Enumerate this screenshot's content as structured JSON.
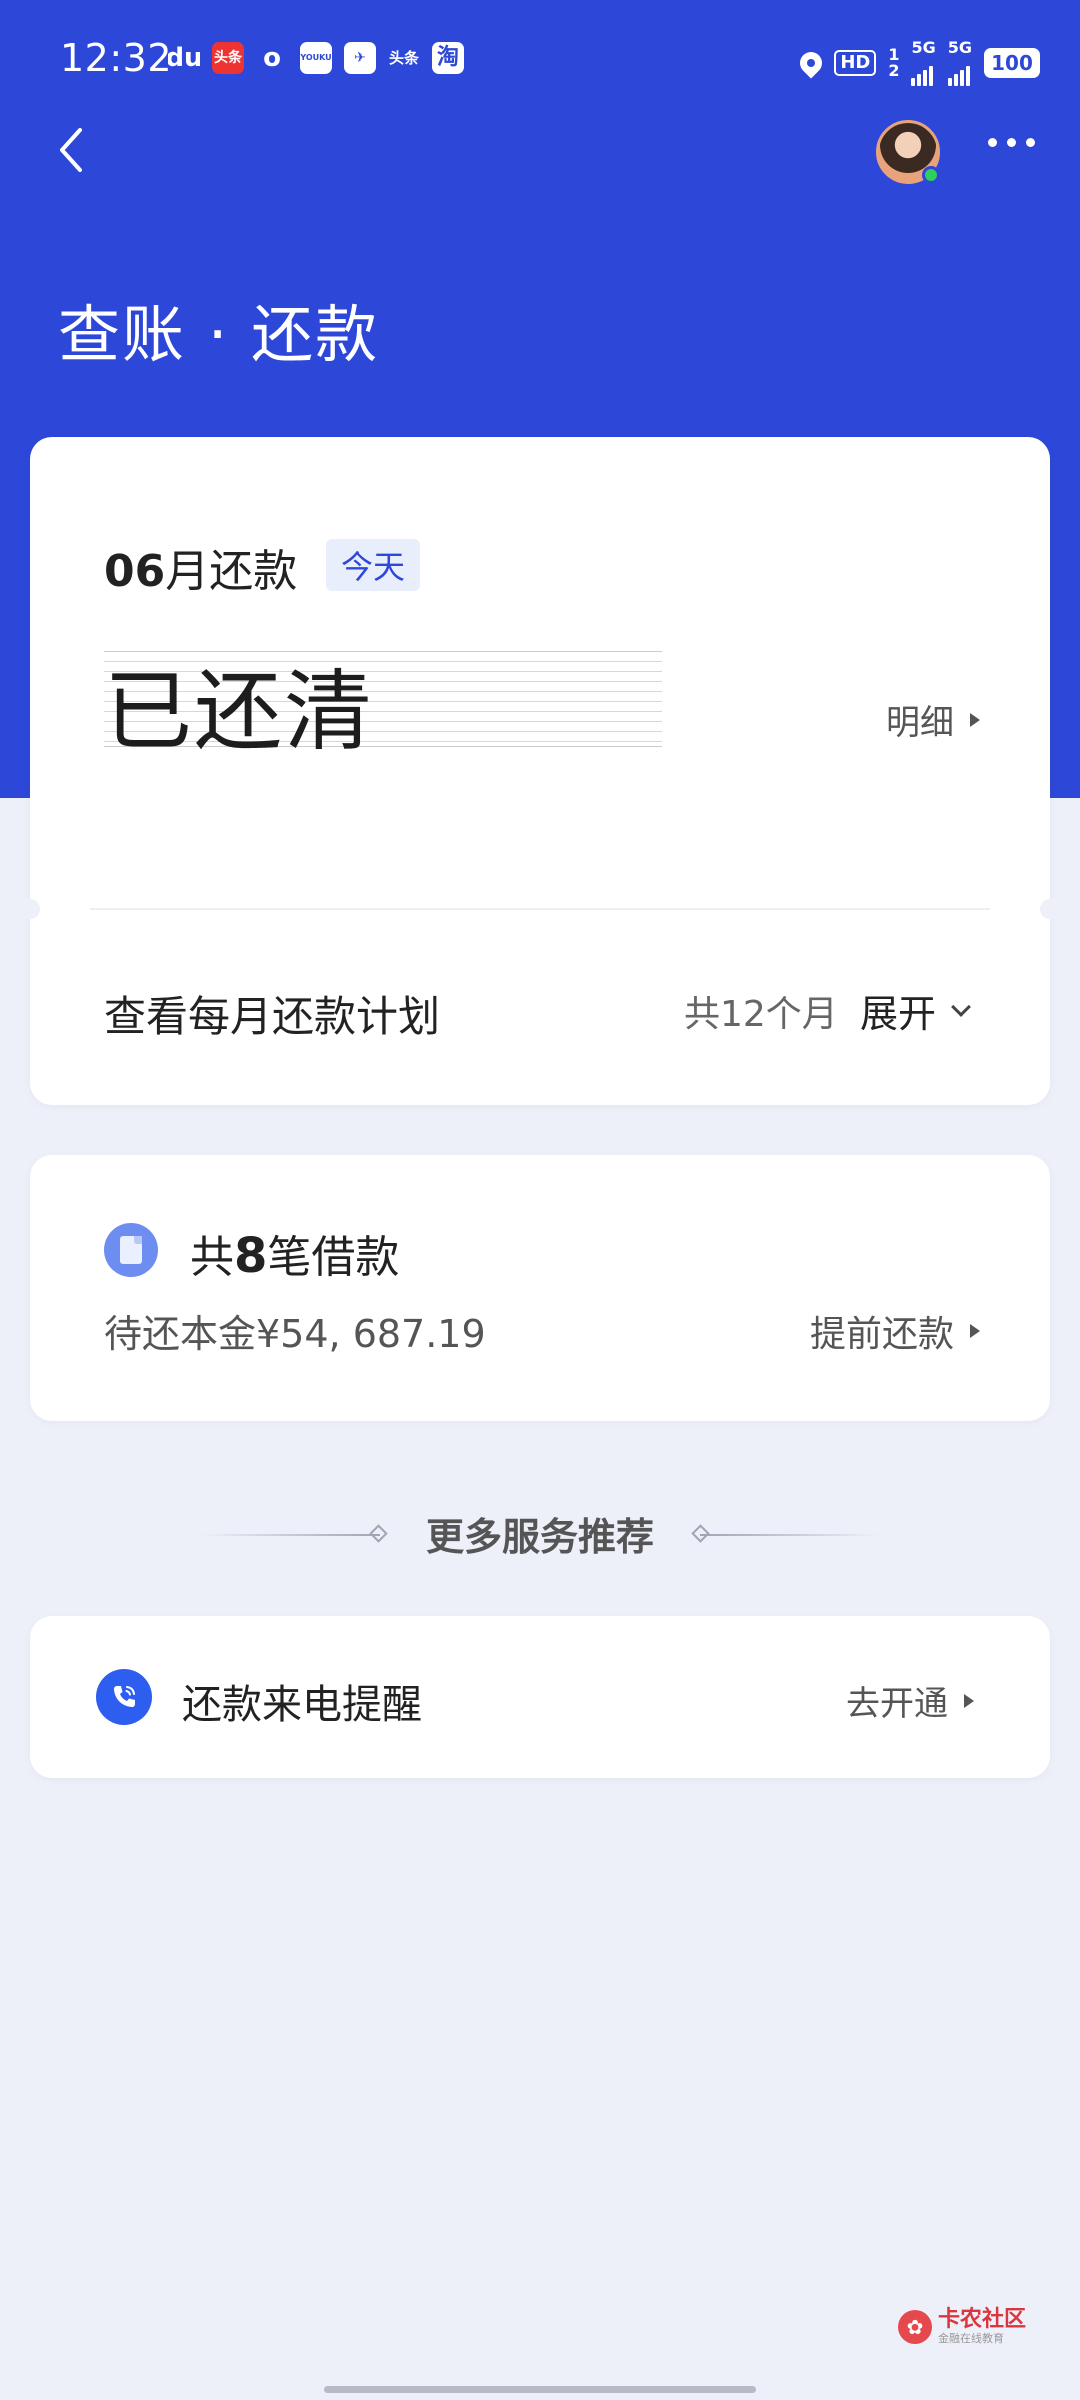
{
  "status_bar": {
    "time": "12:32",
    "app_icons": [
      "du",
      "头条",
      "o",
      "YOUKU",
      "✈",
      "头条",
      "淘"
    ],
    "hd_label": "HD",
    "net_label_1": "5G",
    "net_label_2": "5G",
    "sim_top": "1",
    "sim_bottom": "2",
    "battery": "100"
  },
  "header": {
    "title": "查账 · 还款",
    "accent_color": "#2d48d8"
  },
  "repayment_card": {
    "month_number": "06",
    "month_suffix": "月还款",
    "today_tag": "今天",
    "status": "已还清",
    "detail_link": "明细",
    "plan_label": "查看每月还款计划",
    "plan_months": "共12个月",
    "expand_label": "展开"
  },
  "loans_card": {
    "prefix": "共",
    "count": "8",
    "suffix": "笔借款",
    "principal": "待还本金¥54, 687.19",
    "prepay_link": "提前还款"
  },
  "more_services": {
    "heading": "更多服务推荐"
  },
  "reminder_card": {
    "label": "还款来电提醒",
    "action": "去开通"
  },
  "watermark": {
    "title": "卡农社区",
    "subtitle": "金融在线教育"
  }
}
